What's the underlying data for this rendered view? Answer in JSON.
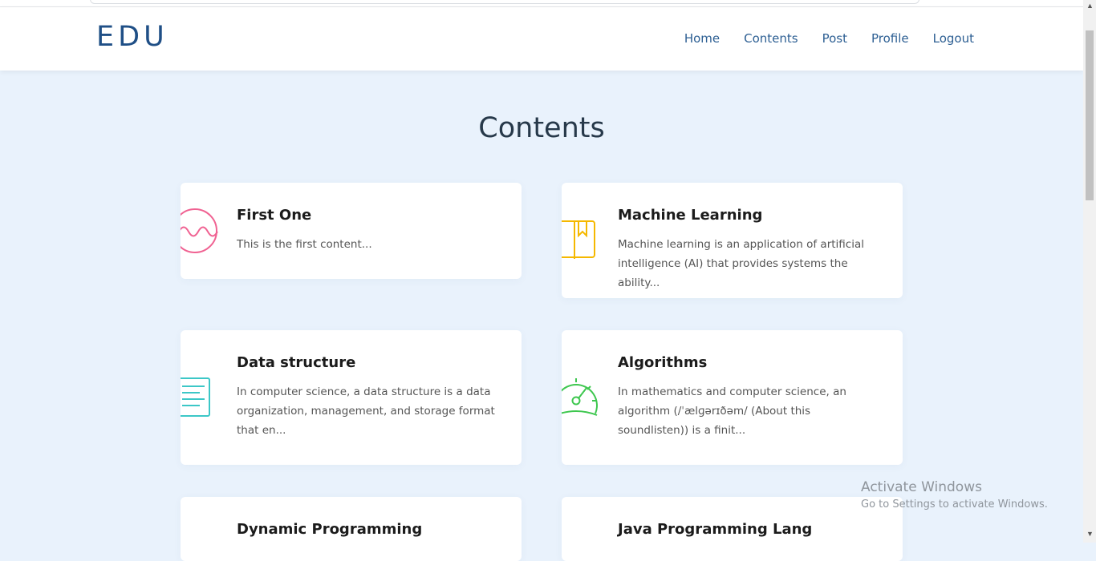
{
  "brand": "EDU",
  "nav": {
    "home": "Home",
    "contents": "Contents",
    "post": "Post",
    "profile": "Profile",
    "logout": "Logout"
  },
  "page_title": "Contents",
  "cards": [
    {
      "title": "First One",
      "text": "This is the first content...",
      "icon": "wave-circle-icon",
      "color": "#f06292"
    },
    {
      "title": "Machine Learning",
      "text": "Machine learning is an application of artificial intelligence (AI) that provides systems the ability...",
      "icon": "book-icon",
      "color": "#f5b800"
    },
    {
      "title": "Data structure",
      "text": "In computer science, a data structure is a data organization, management, and storage format that en...",
      "icon": "document-lines-icon",
      "color": "#3cc7c7"
    },
    {
      "title": "Algorithms",
      "text": "In mathematics and computer science, an algorithm (/ˈælɡərɪðəm/ (About this soundlisten)) is a finit...",
      "icon": "speedometer-icon",
      "color": "#3ec74f"
    },
    {
      "title": "Dynamic Programming",
      "text": "",
      "icon": "",
      "color": ""
    },
    {
      "title": "Java Programming Lang",
      "text": "",
      "icon": "",
      "color": ""
    }
  ],
  "watermark": {
    "line1": "Activate Windows",
    "line2": "Go to Settings to activate Windows."
  }
}
